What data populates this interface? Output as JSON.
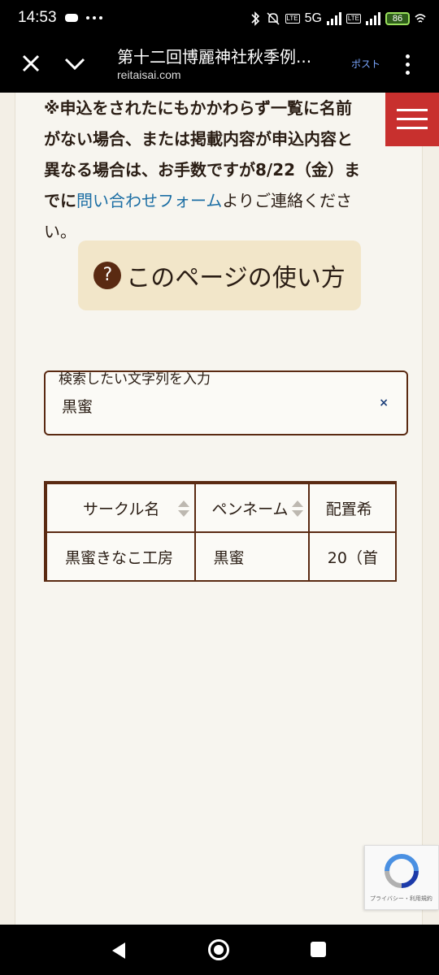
{
  "status_bar": {
    "time": "14:53",
    "network": "5G",
    "battery": "86"
  },
  "browser": {
    "page_title": "第十二回博麗神社秋季例...",
    "url": "reitaisai.com",
    "post_label": "ポスト"
  },
  "notice": {
    "line1": "※申込をされたにもかかわらず一覧に名前",
    "line2": "がない場合、または掲載内容が申込内容と",
    "line3": "異なる場合は、お手数ですが8/22（金）ま",
    "line4_prefix": "でに",
    "link_text": "問い合わせフォーム",
    "line4_suffix": "よりご連絡くださ",
    "line5": "い。"
  },
  "howto": {
    "icon_text": "?",
    "label": "このページの使い方"
  },
  "search": {
    "label": "検索したい文字列を入力",
    "value": "黒蜜",
    "clear_symbol": "×"
  },
  "table": {
    "columns": [
      "サークル名",
      "ペンネーム",
      "配置希"
    ],
    "rows": [
      [
        "黒蜜きなこ工房",
        "黒蜜",
        "20（首"
      ]
    ]
  },
  "recaptcha": {
    "text": "プライバシー・利用規約"
  },
  "colors": {
    "accent_brown": "#5a2a12",
    "menu_red": "#c8302e",
    "link_blue": "#1c6ea4"
  }
}
